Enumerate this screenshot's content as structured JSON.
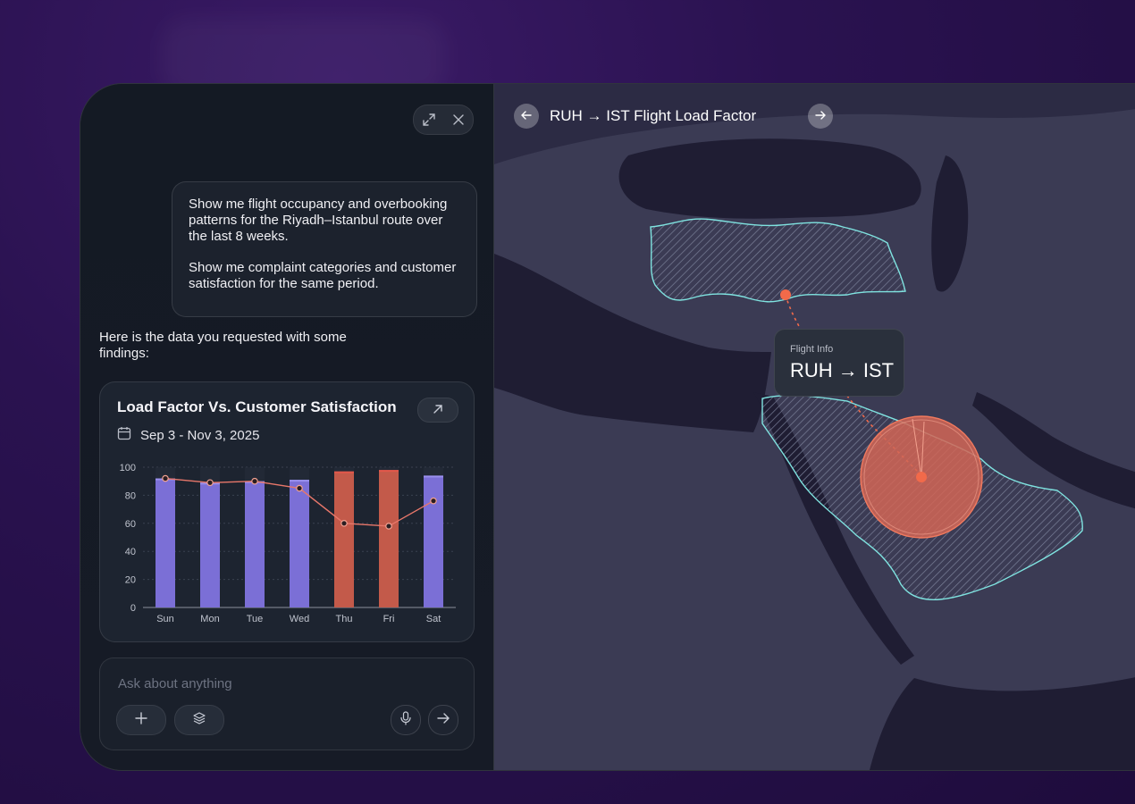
{
  "chat": {
    "user_message": [
      "Show me flight occupancy and overbooking patterns for the Riyadh–Istanbul route over the last 8 weeks.",
      "Show me complaint categories and customer satisfaction for the same period."
    ],
    "assistant_reply": "Here is the data you requested with some findings:"
  },
  "card": {
    "title": "Load Factor Vs. Customer Satisfaction",
    "date_range": "Sep 3 - Nov 3, 2025"
  },
  "chart_data": {
    "type": "bar",
    "categories": [
      "Sun",
      "Mon",
      "Tue",
      "Wed",
      "Thu",
      "Fri",
      "Sat"
    ],
    "series": [
      {
        "values": [
          92,
          89,
          90,
          91,
          97,
          98,
          94
        ]
      },
      {
        "values": [
          92,
          89,
          90,
          85,
          60,
          58,
          76
        ]
      }
    ],
    "highlighted_categories": [
      "Thu",
      "Fri"
    ],
    "ylim": [
      0,
      100
    ],
    "yticks": [
      0,
      20,
      40,
      60,
      80,
      100
    ],
    "grid": true,
    "colors": {
      "bar": "#7b6fd6",
      "bar_highlight": "#c35a4a",
      "line": "#e8776a"
    }
  },
  "input": {
    "placeholder": "Ask about anything"
  },
  "map": {
    "title": "RUH → IST Flight Load Factor",
    "info_label": "Flight Info",
    "info_value": "RUH → IST",
    "colors": {
      "country_outline": "#7fe3e0",
      "marker": "#f26a4a"
    }
  },
  "icons": [
    "expand-icon",
    "close-icon",
    "calendar-icon",
    "arrow-up-right-icon",
    "plus-icon",
    "layers-icon",
    "microphone-icon",
    "send-arrow-icon",
    "arrow-left-icon",
    "arrow-right-icon"
  ]
}
